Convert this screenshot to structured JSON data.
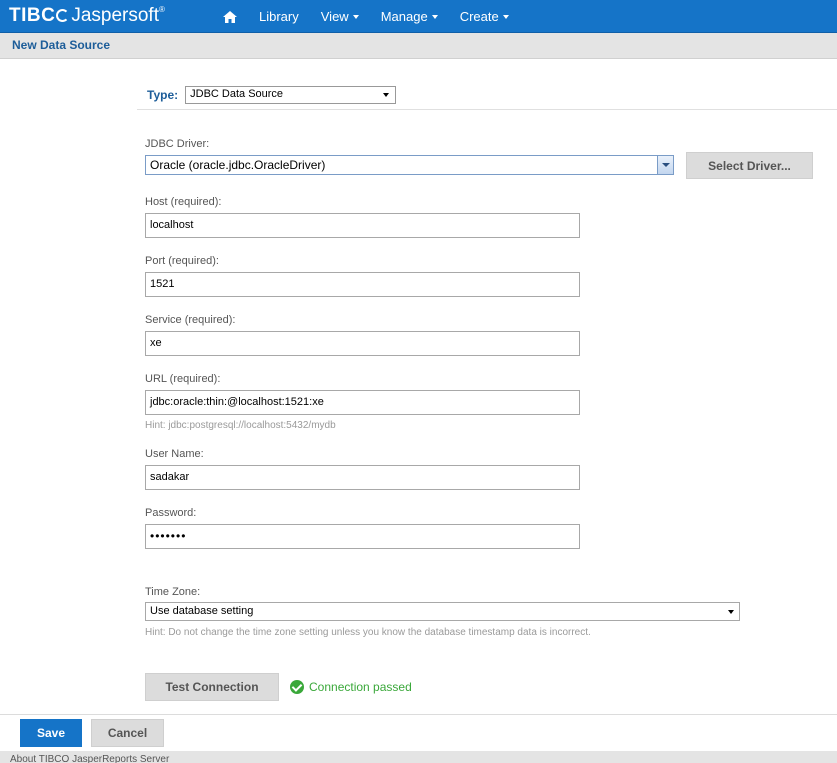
{
  "brand": {
    "name_a": "TIBC",
    "name_b": "Jaspersoft",
    "trademark": "®"
  },
  "nav": {
    "home_icon": "home-icon",
    "items": [
      {
        "label": "Library"
      },
      {
        "label": "View"
      },
      {
        "label": "Manage"
      },
      {
        "label": "Create"
      }
    ]
  },
  "page": {
    "title": "New Data Source"
  },
  "form": {
    "type_label": "Type:",
    "type_value": "JDBC Data Source",
    "driver_label": "JDBC Driver:",
    "driver_value": "Oracle (oracle.jdbc.OracleDriver)",
    "select_driver_label": "Select Driver...",
    "host_label": "Host (required):",
    "host_value": "localhost",
    "port_label": "Port (required):",
    "port_value": "1521",
    "service_label": "Service (required):",
    "service_value": "xe",
    "url_label": "URL (required):",
    "url_value": "jdbc:oracle:thin:@localhost:1521:xe",
    "url_hint": "Hint: jdbc:postgresql://localhost:5432/mydb",
    "username_label": "User Name:",
    "username_value": "sadakar",
    "password_label": "Password:",
    "password_value": "•••••••",
    "timezone_label": "Time Zone:",
    "timezone_value": "Use database setting",
    "timezone_hint": "Hint: Do not change the time zone setting unless you know the database timestamp data is incorrect.",
    "test_connection_label": "Test Connection",
    "status_text": "Connection passed"
  },
  "actions": {
    "save_label": "Save",
    "cancel_label": "Cancel"
  },
  "footer": {
    "about_text": "About TIBCO JasperReports Server"
  },
  "colors": {
    "accent": "#1574c8",
    "title": "#1d5d99",
    "success": "#3aa83a"
  }
}
